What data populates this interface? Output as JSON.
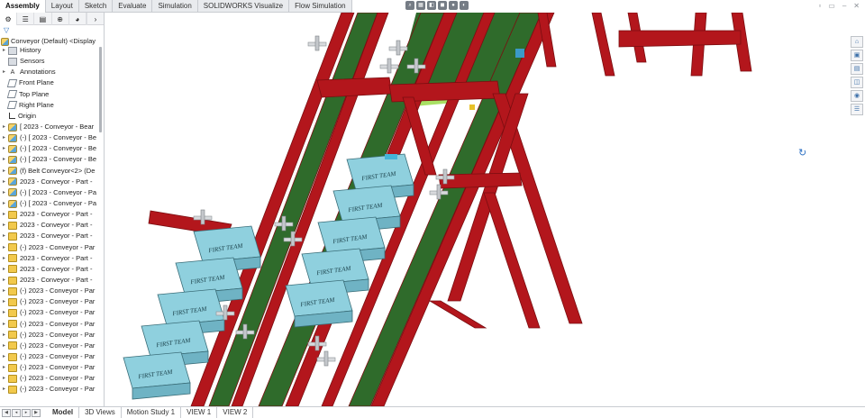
{
  "command_tabs": [
    "Assembly",
    "Layout",
    "Sketch",
    "Evaluate",
    "Simulation",
    "SOLIDWORKS Visualize",
    "Flow Simulation"
  ],
  "active_command_tab": "Assembly",
  "feature_manager": {
    "tab_icons": [
      "feature-manager-icon",
      "property-manager-icon",
      "configuration-manager-icon",
      "dimxpert-icon",
      "display-manager-icon"
    ],
    "root_label": "Conveyor (Default) <Display",
    "items": [
      {
        "label": "History",
        "icon": "folder-icon",
        "caret": "▸"
      },
      {
        "label": "Sensors",
        "icon": "folder-icon",
        "caret": ""
      },
      {
        "label": "Annotations",
        "icon": "annotation-icon",
        "caret": "▸"
      },
      {
        "label": "Front Plane",
        "icon": "plane-icon",
        "caret": ""
      },
      {
        "label": "Top Plane",
        "icon": "plane-icon",
        "caret": ""
      },
      {
        "label": "Right Plane",
        "icon": "plane-icon",
        "caret": ""
      },
      {
        "label": "Origin",
        "icon": "origin-icon",
        "caret": ""
      },
      {
        "label": "[ 2023 - Conveyor - Bear",
        "icon": "subassembly-icon",
        "caret": "▸"
      },
      {
        "label": "(-) [ 2023 - Conveyor - Be",
        "icon": "subassembly-icon",
        "caret": "▸"
      },
      {
        "label": "(-) [ 2023 - Conveyor - Be",
        "icon": "subassembly-icon",
        "caret": "▸"
      },
      {
        "label": "(-) [ 2023 - Conveyor - Be",
        "icon": "subassembly-icon",
        "caret": "▸"
      },
      {
        "label": "(f) Belt Conveyor<2> (De",
        "icon": "subassembly-icon",
        "caret": "▸"
      },
      {
        "label": "2023 - Conveyor - Part -",
        "icon": "subassembly-icon",
        "caret": "▸"
      },
      {
        "label": "(-) [ 2023 - Conveyor - Pa",
        "icon": "subassembly-icon",
        "caret": "▸"
      },
      {
        "label": "(-) [ 2023 - Conveyor - Pa",
        "icon": "subassembly-icon",
        "caret": "▸"
      },
      {
        "label": "2023 - Conveyor - Part -",
        "icon": "part-icon",
        "caret": "▸"
      },
      {
        "label": "2023 - Conveyor - Part -",
        "icon": "part-icon",
        "caret": "▸"
      },
      {
        "label": "2023 - Conveyor - Part -",
        "icon": "part-icon",
        "caret": "▸"
      },
      {
        "label": "(-) 2023 - Conveyor - Par",
        "icon": "part-icon",
        "caret": "▸"
      },
      {
        "label": "2023 - Conveyor - Part -",
        "icon": "part-icon",
        "caret": "▸"
      },
      {
        "label": "2023 - Conveyor - Part -",
        "icon": "part-icon",
        "caret": "▸"
      },
      {
        "label": "2023 - Conveyor - Part -",
        "icon": "part-icon",
        "caret": "▸"
      },
      {
        "label": "(-) 2023 - Conveyor - Par",
        "icon": "part-icon",
        "caret": "▸"
      },
      {
        "label": "(-) 2023 - Conveyor - Par",
        "icon": "part-icon",
        "caret": "▸"
      },
      {
        "label": "(-) 2023 - Conveyor - Par",
        "icon": "part-icon",
        "caret": "▸"
      },
      {
        "label": "(-) 2023 - Conveyor - Par",
        "icon": "part-icon",
        "caret": "▸"
      },
      {
        "label": "(-) 2023 - Conveyor - Par",
        "icon": "part-icon",
        "caret": "▸"
      },
      {
        "label": "(-) 2023 - Conveyor - Par",
        "icon": "part-icon",
        "caret": "▸"
      },
      {
        "label": "(-) 2023 - Conveyor - Par",
        "icon": "part-icon",
        "caret": "▸"
      },
      {
        "label": "(-) 2023 - Conveyor - Par",
        "icon": "part-icon",
        "caret": "▸"
      },
      {
        "label": "(-) 2023 - Conveyor - Par",
        "icon": "part-icon",
        "caret": "▸"
      },
      {
        "label": "(-) 2023 - Conveyor - Par",
        "icon": "part-icon",
        "caret": "▸"
      }
    ]
  },
  "bottom_tabs": [
    "Model",
    "3D Views",
    "Motion Study 1",
    "VIEW 1",
    "VIEW 2"
  ],
  "active_bottom_tab": "Model",
  "box_label": "FIRST TEAM",
  "colors": {
    "frame_red": "#b3161c",
    "frame_dark": "#7a0d10",
    "belt_green": "#2f6b2b",
    "box_blue": "#8fd0de",
    "box_edge": "#3a6d78",
    "accent_blue": "#2f72c4"
  }
}
